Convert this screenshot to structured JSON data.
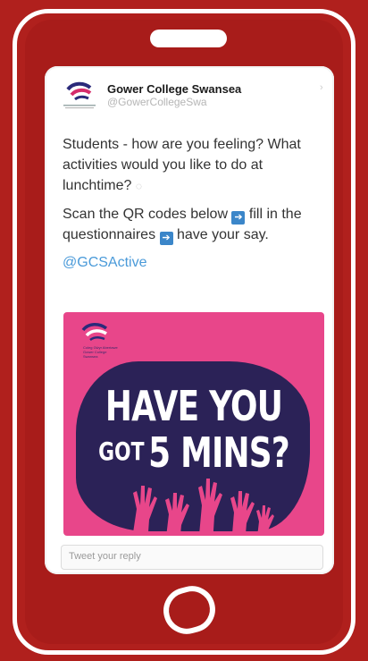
{
  "account": {
    "name": "Gower College Swansea",
    "handle": "@GowerCollegeSwa"
  },
  "tweet": {
    "line1": "Students - how are you feeling? What activities would you like to do at lunchtime?",
    "line2a": "Scan the QR codes below",
    "line2b": "fill in the questionnaires",
    "line2c": "have your say.",
    "mention": "@GCSActive"
  },
  "poster": {
    "headline_top": "HAVE YOU",
    "headline_small": "GOT",
    "headline_big": "5 MINS?",
    "logo_text": "Coleg Gŵyr Abertawe Gower College Swansea"
  },
  "reply": {
    "placeholder": "Tweet your reply"
  },
  "icons": {
    "arrow": "right-arrow-icon",
    "bubble": "speech-bubble-icon",
    "logo": "college-logo-icon"
  },
  "colors": {
    "background": "#b0201d",
    "mention": "#4a9ad9",
    "poster_pink": "#e8468a",
    "poster_navy": "#2b2257"
  }
}
